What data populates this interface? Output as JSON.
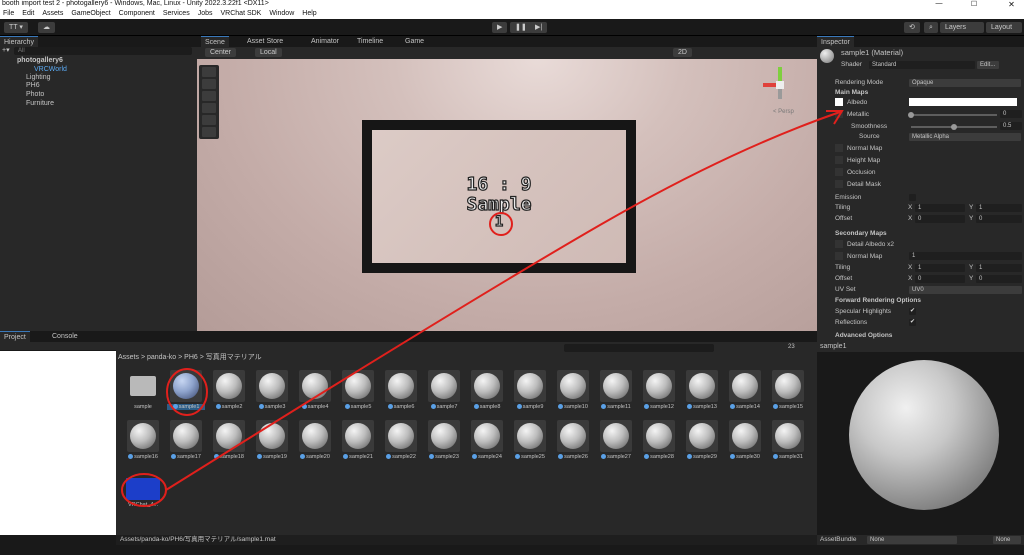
{
  "window": {
    "title": "booth import test 2 - photogallery6 - Windows, Mac, Linux - Unity 2022.3.22f1 <DX11>",
    "min": "—",
    "max": "☐",
    "close": "✕"
  },
  "menu": [
    "File",
    "Edit",
    "Assets",
    "GameObject",
    "Component",
    "Services",
    "Jobs",
    "VRChat SDK",
    "Window",
    "Help"
  ],
  "toolbar": {
    "account": "TT ▾",
    "cloud": "☁",
    "play": "▶",
    "pause": "❚❚",
    "step": "▶|",
    "history": "⟲",
    "search": "⌕",
    "layers": "Layers",
    "layout": "Layout"
  },
  "hierarchy": {
    "tab": "Hierarchy",
    "search_placeholder": "All",
    "add": "+▾",
    "items": [
      {
        "label": "photogallery6"
      },
      {
        "label": "VRCWorld"
      },
      {
        "label": "Lighting"
      },
      {
        "label": "PH6"
      },
      {
        "label": "Photo"
      },
      {
        "label": "Furniture"
      }
    ]
  },
  "scene": {
    "tabs": [
      "Scene",
      "Asset Store",
      "Animator",
      "Timeline",
      "Game"
    ],
    "pivot": "Center",
    "space": "Local",
    "mode2d": "2D",
    "persp": "< Persp",
    "frame_line1": "16 : 9",
    "frame_line2": "Sample",
    "frame_line3": "1"
  },
  "project": {
    "tabs": [
      "Project",
      "Console"
    ],
    "breadcrumb": "Assets > panda-ko > PH6 > 写真用マテリアル",
    "count": "23",
    "status_path": "Assets/panda-ko/PH6/写真用マテリアル/sample1.mat",
    "row1": [
      "sample",
      "sample1",
      "sample2",
      "sample3",
      "sample4",
      "sample5",
      "sample6",
      "sample7",
      "sample8",
      "sample9",
      "sample10",
      "sample11",
      "sample12",
      "sample13",
      "sample14",
      "sample15"
    ],
    "row2": [
      "sample16",
      "sample17",
      "sample18",
      "sample19",
      "sample20",
      "sample21",
      "sample22",
      "sample23",
      "sample24",
      "sample25",
      "sample26",
      "sample27",
      "sample28",
      "sample29",
      "sample30",
      "sample31"
    ],
    "row3": [
      "VRChat_4..."
    ]
  },
  "inspector": {
    "tab": "Inspector",
    "material": "sample1 (Material)",
    "shader_label": "Shader",
    "shader_value": "Standard",
    "edit": "Edit...",
    "rendering_mode_label": "Rendering Mode",
    "rendering_mode_value": "Opaque",
    "main_maps": "Main Maps",
    "albedo": "Albedo",
    "metallic": "Metallic",
    "metallic_value": "0",
    "smoothness": "Smoothness",
    "smoothness_value": "0.5",
    "smoothness_fraction": 0.5,
    "source": "Source",
    "source_value": "Metallic Alpha",
    "normal_map": "Normal Map",
    "height_map": "Height Map",
    "occlusion": "Occlusion",
    "detail_mask": "Detail Mask",
    "emission": "Emission",
    "tiling": "Tiling",
    "offset": "Offset",
    "x": "X",
    "y": "Y",
    "tiling_x": "1",
    "tiling_y": "1",
    "offset_x": "0",
    "offset_y": "0",
    "secondary_maps": "Secondary Maps",
    "detail_albedo": "Detail Albedo x2",
    "normal_map2": "Normal Map",
    "normal_map2_value": "1",
    "uvset": "UV Set",
    "uvset_value": "UV0",
    "forward": "Forward Rendering Options",
    "specular": "Specular Highlights",
    "reflections": "Reflections",
    "advanced": "Advanced Options",
    "check": "✔"
  },
  "preview": {
    "title": "sample1",
    "assetbundle_label": "AssetBundle",
    "assetbundle_value": "None",
    "assetbundle_variant": "None"
  },
  "colors": {
    "annotation": "#e0201c",
    "accent": "#3a79bb"
  }
}
